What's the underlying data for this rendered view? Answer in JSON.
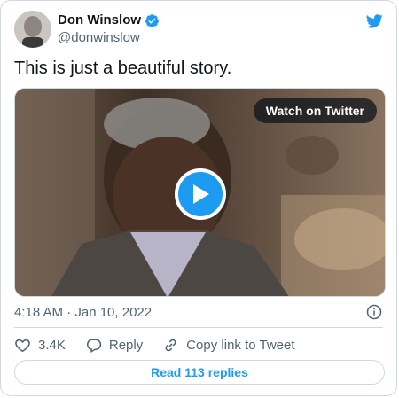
{
  "author": {
    "name": "Don Winslow",
    "handle": "@donwinslow"
  },
  "tweet": {
    "text": "This is just a beautiful story."
  },
  "media": {
    "watch_label": "Watch on Twitter"
  },
  "meta": {
    "timestamp": "4:18 AM · Jan 10, 2022"
  },
  "actions": {
    "likes": "3.4K",
    "reply_label": "Reply",
    "copy_link_label": "Copy link to Tweet"
  },
  "replies_button": {
    "label": "Read 113 replies"
  },
  "colors": {
    "accent": "#1d9bf0",
    "text": "#0f1419",
    "muted": "#536471",
    "border": "#cfd9de"
  },
  "icons": [
    "verified-badge-icon",
    "twitter-bird-icon",
    "play-icon",
    "info-icon",
    "heart-icon",
    "reply-icon",
    "link-icon"
  ]
}
